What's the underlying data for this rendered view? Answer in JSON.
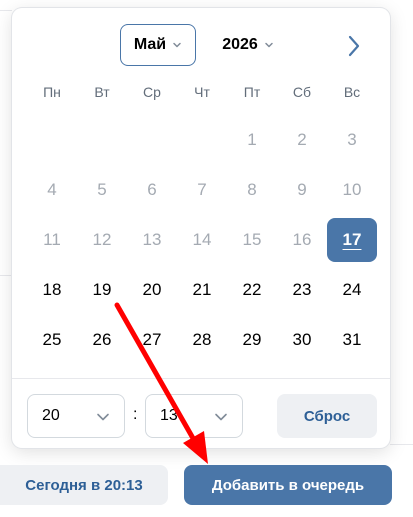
{
  "datepicker": {
    "month": "Май",
    "year": "2026",
    "weekdays": [
      "Пн",
      "Вт",
      "Ср",
      "Чт",
      "Пт",
      "Сб",
      "Вс"
    ],
    "days": [
      [
        null,
        null,
        null,
        null,
        "1",
        "2",
        "3"
      ],
      [
        "4",
        "5",
        "6",
        "7",
        "8",
        "9",
        "10"
      ],
      [
        "11",
        "12",
        "13",
        "14",
        "15",
        "16",
        "17"
      ],
      [
        "18",
        "19",
        "20",
        "21",
        "22",
        "23",
        "24"
      ],
      [
        "25",
        "26",
        "27",
        "28",
        "29",
        "30",
        "31"
      ]
    ],
    "disabled_days": [
      "1",
      "2",
      "3",
      "4",
      "5",
      "6",
      "7",
      "8",
      "9",
      "10",
      "11",
      "12",
      "13",
      "14",
      "15",
      "16"
    ],
    "selected_day": "17",
    "hour": "20",
    "minute": "13",
    "colon": ":",
    "reset_label": "Сброс"
  },
  "footer": {
    "today_label": "Сегодня в 20:13",
    "add_label": "Добавить в очередь"
  },
  "colors": {
    "accent": "#4a76a8",
    "secondary_text": "#2d5f96",
    "disabled": "#a4aab2",
    "annotation_arrow": "#ff0000"
  },
  "icons": {
    "month_dropdown": "chevron-down-icon",
    "year_dropdown": "chevron-down-icon",
    "next_month": "chevron-right-icon",
    "hour_dropdown": "chevron-down-icon",
    "minute_dropdown": "chevron-down-icon"
  }
}
